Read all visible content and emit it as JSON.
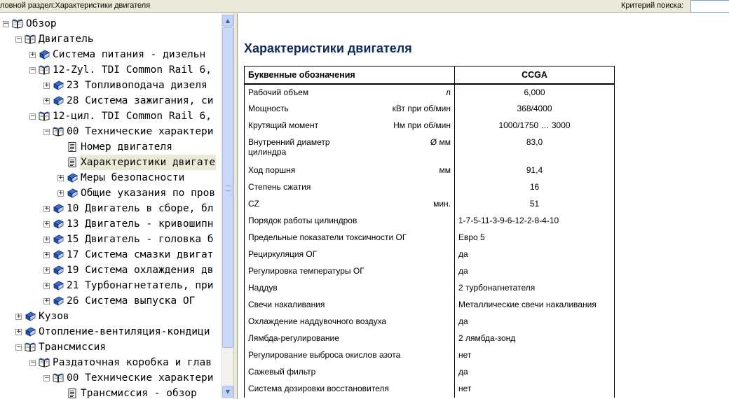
{
  "header": {
    "section_label": "ловной раздел:Характеристики двигателя",
    "search_label": "Критерий поиска:",
    "search_value": ""
  },
  "tree": [
    {
      "label": "Обзор",
      "icon": "open-book-icon",
      "expander": "-",
      "level": 0
    },
    {
      "label": "Двигатель",
      "icon": "open-book-icon",
      "expander": "-",
      "level": 1
    },
    {
      "label": "Система питания - дизельн",
      "icon": "closed-book-icon",
      "expander": "+",
      "level": 2
    },
    {
      "label": "12-Zyl. TDI Common Rail 6,",
      "icon": "open-book-icon",
      "expander": "-",
      "level": 2
    },
    {
      "label": "23 Топливоподача дизеля",
      "icon": "closed-book-icon",
      "expander": "+",
      "level": 3
    },
    {
      "label": "28 Система зажигания, си",
      "icon": "closed-book-icon",
      "expander": "+",
      "level": 3
    },
    {
      "label": "12-цил. TDI Common Rail 6,",
      "icon": "open-book-icon",
      "expander": "-",
      "level": 2
    },
    {
      "label": "00 Технические характери",
      "icon": "open-book-icon",
      "expander": "-",
      "level": 3
    },
    {
      "label": "Номер двигателя",
      "icon": "document-icon",
      "expander": "",
      "level": 4
    },
    {
      "label": "Характеристики двигате",
      "icon": "document-icon",
      "expander": "",
      "level": 4,
      "selected": true
    },
    {
      "label": "Меры безопасности",
      "icon": "closed-book-icon",
      "expander": "+",
      "level": 4
    },
    {
      "label": "Общие указания по пров",
      "icon": "closed-book-icon",
      "expander": "+",
      "level": 4
    },
    {
      "label": "10 Двигатель в сборе, бл",
      "icon": "closed-book-icon",
      "expander": "+",
      "level": 3
    },
    {
      "label": "13 Двигатель - кривошипн",
      "icon": "closed-book-icon",
      "expander": "+",
      "level": 3
    },
    {
      "label": "15 Двигатель - головка б",
      "icon": "closed-book-icon",
      "expander": "+",
      "level": 3
    },
    {
      "label": "17 Система смазки двигат",
      "icon": "closed-book-icon",
      "expander": "+",
      "level": 3
    },
    {
      "label": "19 Система охлаждения дв",
      "icon": "closed-book-icon",
      "expander": "+",
      "level": 3
    },
    {
      "label": "21 Турбонагнетатель, при",
      "icon": "closed-book-icon",
      "expander": "+",
      "level": 3
    },
    {
      "label": "26 Система выпуска ОГ",
      "icon": "closed-book-icon",
      "expander": "+",
      "level": 3
    },
    {
      "label": "Кузов",
      "icon": "closed-book-icon",
      "expander": "+",
      "level": 1
    },
    {
      "label": "Отопление-вентиляция-кондици",
      "icon": "closed-book-icon",
      "expander": "+",
      "level": 1
    },
    {
      "label": "Трансмиссия",
      "icon": "open-book-icon",
      "expander": "-",
      "level": 1
    },
    {
      "label": "Раздаточная коробка и глав",
      "icon": "open-book-icon",
      "expander": "-",
      "level": 2
    },
    {
      "label": "00 Технические характери",
      "icon": "open-book-icon",
      "expander": "-",
      "level": 3
    },
    {
      "label": "Трансмиссия - обзор",
      "icon": "document-icon",
      "expander": "",
      "level": 4
    }
  ],
  "scrollbar": {
    "up_arrow": "up-arrow-icon",
    "down_arrow": "down-arrow-icon"
  },
  "content": {
    "title": "Характеристики двигателя",
    "table": {
      "header_name": "Буквенные обозначения",
      "header_value": "CCGA",
      "rows": [
        {
          "name": "Рабочий объем",
          "unit": "л",
          "value": "6,000",
          "align": "center"
        },
        {
          "name": "Мощность",
          "unit": "кВт при об/мин",
          "value": "368/4000",
          "align": "center"
        },
        {
          "name": "Крутящий момент",
          "unit": "Нм при об/мин",
          "value": "1000/1750 … 3000",
          "align": "center"
        },
        {
          "name": "Внутренний диаметр цилиндра",
          "unit": "Ø мм",
          "value": "83,0",
          "align": "center",
          "tall": true
        },
        {
          "name": "Ход поршня",
          "unit": "мм",
          "value": "91,4",
          "align": "center"
        },
        {
          "name": "Степень сжатия",
          "unit": "",
          "value": "16",
          "align": "center"
        },
        {
          "name": "CZ",
          "unit": "мин.",
          "value": "51",
          "align": "center"
        },
        {
          "name": "Порядок работы цилиндров",
          "unit": "",
          "value": "1-7-5-11-3-9-6-12-2-8-4-10",
          "align": "left"
        },
        {
          "name": "Предельные показатели токсичности ОГ",
          "unit": "",
          "value": "Евро 5",
          "align": "left"
        },
        {
          "name": "Рециркуляция ОГ",
          "unit": "",
          "value": "да",
          "align": "left"
        },
        {
          "name": "Регулировка температуры ОГ",
          "unit": "",
          "value": "да",
          "align": "left"
        },
        {
          "name": "Наддув",
          "unit": "",
          "value": "2 турбонагнетателя",
          "align": "left"
        },
        {
          "name": "Свечи накаливания",
          "unit": "",
          "value": "Металлические свечи накаливания",
          "align": "left"
        },
        {
          "name": "Охлаждение наддувочного воздуха",
          "unit": "",
          "value": "да",
          "align": "left"
        },
        {
          "name": "Лямбда-регулирование",
          "unit": "",
          "value": "2 лямбда-зонд",
          "align": "left"
        },
        {
          "name": "Регулирование выброса окислов азота",
          "unit": "",
          "value": "нет",
          "align": "left"
        },
        {
          "name": "Сажевый фильтр",
          "unit": "",
          "value": "да",
          "align": "left"
        },
        {
          "name": "Система дозировки восстановителя",
          "unit": "",
          "value": "нет",
          "align": "left"
        }
      ]
    }
  },
  "colors": {
    "title": "#0d2b5c",
    "selection": "#ece9d8",
    "book_blue": "#1f4fa8"
  }
}
